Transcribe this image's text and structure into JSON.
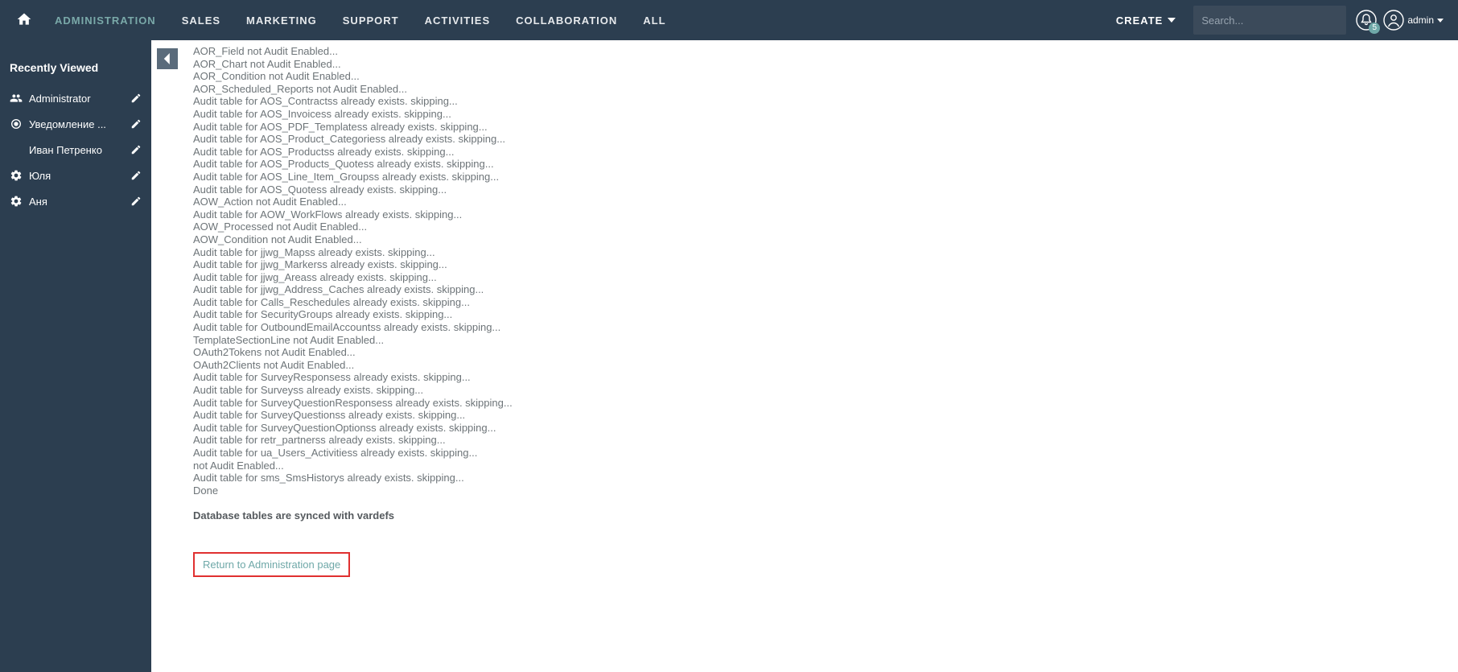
{
  "topnav": {
    "tabs": [
      {
        "label": "ADMINISTRATION",
        "active": true
      },
      {
        "label": "SALES"
      },
      {
        "label": "MARKETING"
      },
      {
        "label": "SUPPORT"
      },
      {
        "label": "ACTIVITIES"
      },
      {
        "label": "COLLABORATION"
      },
      {
        "label": "ALL"
      }
    ],
    "create_label": "CREATE",
    "search_placeholder": "Search...",
    "notification_count": "5",
    "username": "admin"
  },
  "sidebar": {
    "title": "Recently Viewed",
    "items": [
      {
        "icon": "people",
        "label": "Administrator"
      },
      {
        "icon": "target",
        "label": "Уведомление ..."
      },
      {
        "icon": "none",
        "label": "Иван Петренко"
      },
      {
        "icon": "gear",
        "label": "Юля"
      },
      {
        "icon": "gear",
        "label": "Аня"
      }
    ]
  },
  "main": {
    "log_lines": [
      "AOR_Field not Audit Enabled...",
      "AOR_Chart not Audit Enabled...",
      "AOR_Condition not Audit Enabled...",
      "AOR_Scheduled_Reports not Audit Enabled...",
      "Audit table for AOS_Contractss already exists. skipping...",
      "Audit table for AOS_Invoicess already exists. skipping...",
      "Audit table for AOS_PDF_Templatess already exists. skipping...",
      "Audit table for AOS_Product_Categoriess already exists. skipping...",
      "Audit table for AOS_Productss already exists. skipping...",
      "Audit table for AOS_Products_Quotess already exists. skipping...",
      "Audit table for AOS_Line_Item_Groupss already exists. skipping...",
      "Audit table for AOS_Quotess already exists. skipping...",
      "AOW_Action not Audit Enabled...",
      "Audit table for AOW_WorkFlows already exists. skipping...",
      "AOW_Processed not Audit Enabled...",
      "AOW_Condition not Audit Enabled...",
      "Audit table for jjwg_Mapss already exists. skipping...",
      "Audit table for jjwg_Markerss already exists. skipping...",
      "Audit table for jjwg_Areass already exists. skipping...",
      "Audit table for jjwg_Address_Caches already exists. skipping...",
      "Audit table for Calls_Reschedules already exists. skipping...",
      "Audit table for SecurityGroups already exists. skipping...",
      "Audit table for OutboundEmailAccountss already exists. skipping...",
      "TemplateSectionLine not Audit Enabled...",
      "OAuth2Tokens not Audit Enabled...",
      "OAuth2Clients not Audit Enabled...",
      "Audit table for SurveyResponsess already exists. skipping...",
      "Audit table for Surveyss already exists. skipping...",
      "Audit table for SurveyQuestionResponsess already exists. skipping...",
      "Audit table for SurveyQuestionss already exists. skipping...",
      "Audit table for SurveyQuestionOptionss already exists. skipping...",
      "Audit table for retr_partnerss already exists. skipping...",
      "Audit table for ua_Users_Activitiess already exists. skipping...",
      "not Audit Enabled...",
      "Audit table for sms_SmsHistorys already exists. skipping...",
      "Done"
    ],
    "status_line": "Database tables are synced with vardefs",
    "return_link_label": "Return to Administration page"
  }
}
